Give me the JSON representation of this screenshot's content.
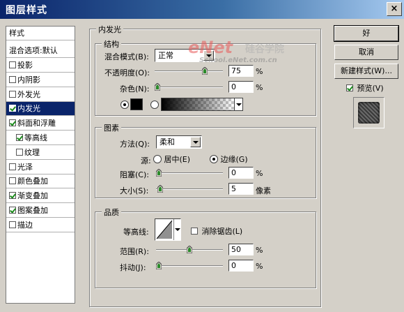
{
  "window": {
    "title": "图层样式",
    "close": "×"
  },
  "style_list": {
    "header": "样式",
    "blend_options": "混合选项:默认",
    "items": [
      {
        "label": "投影",
        "checked": false
      },
      {
        "label": "内阴影",
        "checked": false
      },
      {
        "label": "外发光",
        "checked": false
      },
      {
        "label": "内发光",
        "checked": true,
        "selected": true
      },
      {
        "label": "斜面和浮雕",
        "checked": true
      },
      {
        "label": "等高线",
        "checked": true,
        "sub": true
      },
      {
        "label": "纹理",
        "checked": false,
        "sub": true
      },
      {
        "label": "光泽",
        "checked": false
      },
      {
        "label": "颜色叠加",
        "checked": false
      },
      {
        "label": "渐变叠加",
        "checked": true
      },
      {
        "label": "图案叠加",
        "checked": true
      },
      {
        "label": "描边",
        "checked": false
      }
    ]
  },
  "inner_glow": {
    "title": "内发光",
    "structure": {
      "title": "结构",
      "blend_mode_label": "混合模式(B):",
      "blend_mode_value": "正常",
      "opacity_label": "不透明度(O):",
      "opacity_value": "75",
      "opacity_unit": "%",
      "opacity_fraction": 0.75,
      "noise_label": "杂色(N):",
      "noise_value": "0",
      "noise_unit": "%",
      "noise_fraction": 0
    },
    "elements": {
      "title": "图素",
      "technique_label": "方法(Q):",
      "technique_value": "柔和",
      "source_label": "源:",
      "source_center": "居中(E)",
      "source_edge": "边缘(G)",
      "choke_label": "阻塞(C):",
      "choke_value": "0",
      "choke_unit": "%",
      "choke_fraction": 0,
      "size_label": "大小(S):",
      "size_value": "5",
      "size_unit": "像素",
      "size_fraction": 0.02
    },
    "quality": {
      "title": "品质",
      "contour_label": "等高线:",
      "antialias_label": "消除锯齿(L)",
      "range_label": "范围(R):",
      "range_value": "50",
      "range_unit": "%",
      "range_fraction": 0.5,
      "jitter_label": "抖动(J):",
      "jitter_value": "0",
      "jitter_unit": "%",
      "jitter_fraction": 0
    }
  },
  "buttons": {
    "ok": "好",
    "cancel": "取消",
    "new_style": "新建样式(W)...",
    "preview": "预览(V)"
  },
  "watermark": {
    "logo": "eNet",
    "cn": "硅谷学院",
    "url": "School.eNet.com.cn"
  },
  "colors": {
    "selection": "#0a246a",
    "face": "#d4d0c8",
    "swatch": "#000000"
  }
}
